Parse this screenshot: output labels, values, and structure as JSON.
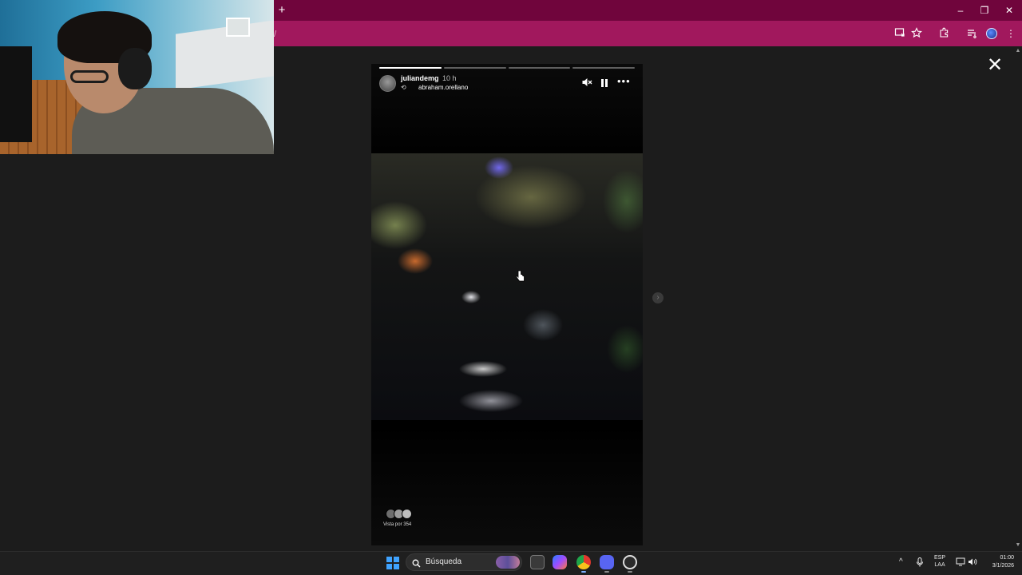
{
  "browser": {
    "new_tab_label": "+",
    "address_fragment": "/",
    "window_controls": {
      "minimize": "–",
      "restore": "❐",
      "close": "✕"
    },
    "accent_colors": {
      "tabbar": "#70053c",
      "toolbar": "#a1185d"
    }
  },
  "viewer": {
    "close_label": "✕"
  },
  "story": {
    "username": "juliandemg",
    "time_ago": "10 h",
    "repost_from": "abraham.orellano",
    "progress": [
      1.0,
      0.0,
      0.0,
      0.0
    ],
    "more_label": "•••",
    "viewers_label": "Vista por 354",
    "next_label": "›"
  },
  "taskbar": {
    "search_placeholder": "Búsqueda",
    "apps": [
      "file-explorer-icon",
      "copilot-icon",
      "chrome-icon",
      "discord-icon",
      "obs-icon"
    ],
    "lang_top": "ESP",
    "lang_bottom": "LAA",
    "time": "01:00",
    "date": "3/1/2026",
    "tray_arrow": "^"
  }
}
